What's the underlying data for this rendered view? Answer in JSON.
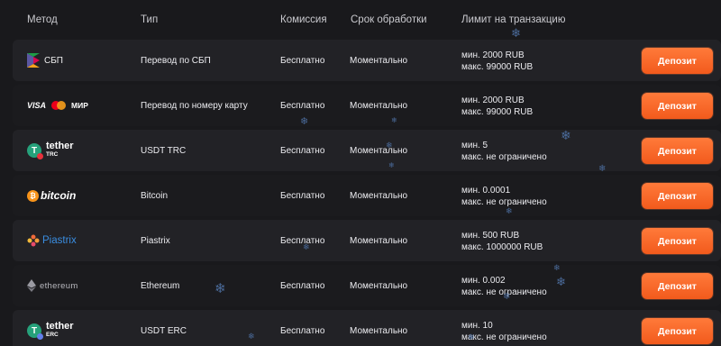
{
  "header": {
    "method": "Метод",
    "type": "Тип",
    "fee": "Комиссия",
    "time": "Срок обработки",
    "limit": "Лимит на транзакцию"
  },
  "rows": [
    {
      "logo": "СБП",
      "type": "Перевод по СБП",
      "fee": "Бесплатно",
      "time": "Моментально",
      "min": "мин. 2000 RUB",
      "max": "макс. 99000 RUB",
      "button": "Депозит"
    },
    {
      "logo_visa": "VISA",
      "logo_mir": "МИР",
      "type": "Перевод по номеру карту",
      "fee": "Бесплатно",
      "time": "Моментально",
      "min": "мин. 2000 RUB",
      "max": "макс. 99000 RUB",
      "button": "Депозит"
    },
    {
      "logo": "tether",
      "logo_sub": "TRC",
      "type": "USDT TRC",
      "fee": "Бесплатно",
      "time": "Моментально",
      "min": "мин. 5",
      "max": "макс. не ограничено",
      "button": "Депозит"
    },
    {
      "logo": "bitcoin",
      "type": "Bitcoin",
      "fee": "Бесплатно",
      "time": "Моментально",
      "min": "мин. 0.0001",
      "max": "макс. не ограничено",
      "button": "Депозит"
    },
    {
      "logo": "Piastrix",
      "type": "Piastrix",
      "fee": "Бесплатно",
      "time": "Моментально",
      "min": "мин. 500 RUB",
      "max": "макс. 1000000 RUB",
      "button": "Депозит"
    },
    {
      "logo": "ethereum",
      "type": "Ethereum",
      "fee": "Бесплатно",
      "time": "Моментально",
      "min": "мин. 0.002",
      "max": "макс. не ограничено",
      "button": "Депозит"
    },
    {
      "logo": "tether",
      "logo_sub": "ERC",
      "type": "USDT ERC",
      "fee": "Бесплатно",
      "time": "Моментально",
      "min": "мин. 10",
      "max": "макс. не ограничено",
      "button": "Депозит"
    }
  ],
  "colors": {
    "accent": "#f25a1c",
    "usdt_green": "#26a17b",
    "btc_orange": "#f7931a",
    "piastrix_blue": "#3a8de0"
  }
}
